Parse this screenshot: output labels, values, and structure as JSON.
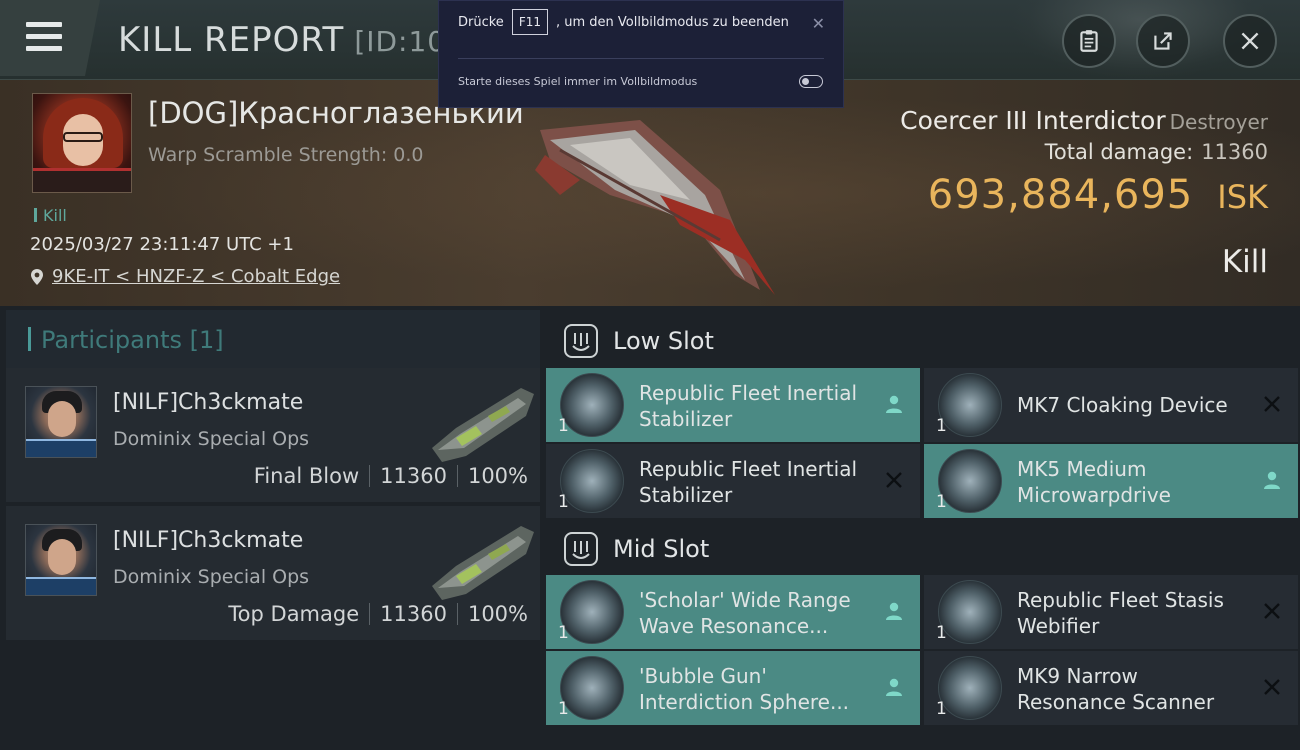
{
  "header": {
    "title": "KILL REPORT",
    "id_label": "[ID:10500012]"
  },
  "fullscreen_popup": {
    "text_before": "Drücke",
    "key": "F11",
    "text_after": ", um den Vollbildmodus zu beenden",
    "option_label": "Starte dieses Spiel immer im Vollbildmodus",
    "option_enabled": false
  },
  "victim": {
    "name": "[DOG]Красноглазенький",
    "warp_scramble": "Warp Scramble Strength: 0.0",
    "tag": "Kill",
    "timestamp": "2025/03/27 23:11:47 UTC +1",
    "location": "9KE-IT < HNZF-Z < Cobalt Edge",
    "ship_name": "Coercer III Interdictor",
    "ship_class": "Destroyer",
    "total_damage_label": "Total damage:",
    "total_damage_value": "11360",
    "isk_amount": "693,884,695",
    "isk_unit": "ISK",
    "result": "Kill"
  },
  "participants": {
    "title": "Participants [1]",
    "items": [
      {
        "name": "[NILF]Ch3ckmate",
        "ship": "Dominix Special Ops",
        "role": "Final Blow",
        "damage": "11360",
        "percent": "100%"
      },
      {
        "name": "[NILF]Ch3ckmate",
        "ship": "Dominix Special Ops",
        "role": "Top Damage",
        "damage": "11360",
        "percent": "100%"
      }
    ]
  },
  "fitting": {
    "low_slot": {
      "title": "Low Slot",
      "modules": [
        {
          "name": "Republic Fleet Inertial Stabilizer",
          "qty": "1",
          "status": "fitted"
        },
        {
          "name": "MK7 Cloaking Device",
          "qty": "1",
          "status": "destroyed"
        },
        {
          "name": "Republic Fleet Inertial Stabilizer",
          "qty": "1",
          "status": "destroyed"
        },
        {
          "name": "MK5 Medium Microwarpdrive",
          "qty": "1",
          "status": "fitted"
        }
      ]
    },
    "mid_slot": {
      "title": "Mid Slot",
      "modules": [
        {
          "name": "'Scholar' Wide Range Wave Resonance...",
          "qty": "1",
          "status": "fitted"
        },
        {
          "name": "Republic Fleet Stasis Webifier",
          "qty": "1",
          "status": "destroyed"
        },
        {
          "name": "'Bubble Gun' Interdiction Sphere...",
          "qty": "1",
          "status": "fitted"
        },
        {
          "name": "MK9 Narrow Resonance Scanner",
          "qty": "1",
          "status": "destroyed"
        }
      ]
    }
  },
  "colors": {
    "accent_teal": "#4b8a84",
    "isk_gold": "#e9b55c",
    "popup_bg": "#1c2037"
  }
}
